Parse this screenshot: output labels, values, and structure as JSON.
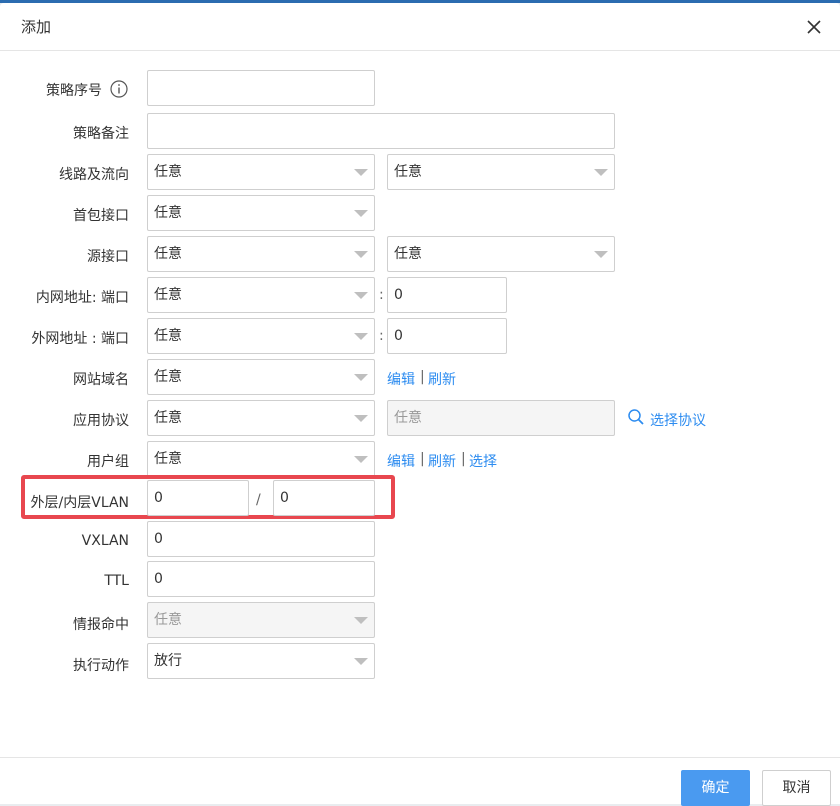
{
  "dialog": {
    "title": "添加"
  },
  "form": {
    "policy_seq": {
      "label": "策略序号",
      "value": ""
    },
    "policy_note": {
      "label": "策略备注",
      "value": ""
    },
    "line_flow": {
      "label": "线路及流向",
      "value1": "任意",
      "value2": "任意"
    },
    "first_pkt_if": {
      "label": "首包接口",
      "value": "任意"
    },
    "src_if": {
      "label": "源接口",
      "value1": "任意",
      "value2": "任意"
    },
    "lan_addr": {
      "label": "内网地址: 端口",
      "value": "任意",
      "sep": ":",
      "port": "0"
    },
    "wan_addr": {
      "label": "外网地址 : 端口",
      "value": "任意",
      "sep": ":",
      "port": "0"
    },
    "site_domain": {
      "label": "网站域名",
      "value": "任意",
      "edit": "编辑",
      "refresh": "刷新"
    },
    "app_proto": {
      "label": "应用协议",
      "value": "任意",
      "value2": "任意",
      "select_link": "选择协议"
    },
    "user_group": {
      "label": "用户组",
      "value": "任意",
      "edit": "编辑",
      "refresh": "刷新",
      "select": "选择"
    },
    "vlan": {
      "label": "外层/内层VLAN",
      "outer": "0",
      "slash": "/",
      "inner": "0"
    },
    "vxlan": {
      "label": "VXLAN",
      "value": "0"
    },
    "ttl": {
      "label": "TTL",
      "value": "0"
    },
    "intel_hit": {
      "label": "情报命中",
      "value": "任意"
    },
    "action": {
      "label": "执行动作",
      "value": "放行"
    }
  },
  "footer": {
    "ok": "确定",
    "cancel": "取消"
  },
  "colors": {
    "accent": "#4a9af0",
    "link": "#2d8cf0",
    "highlight": "#e8474f"
  }
}
